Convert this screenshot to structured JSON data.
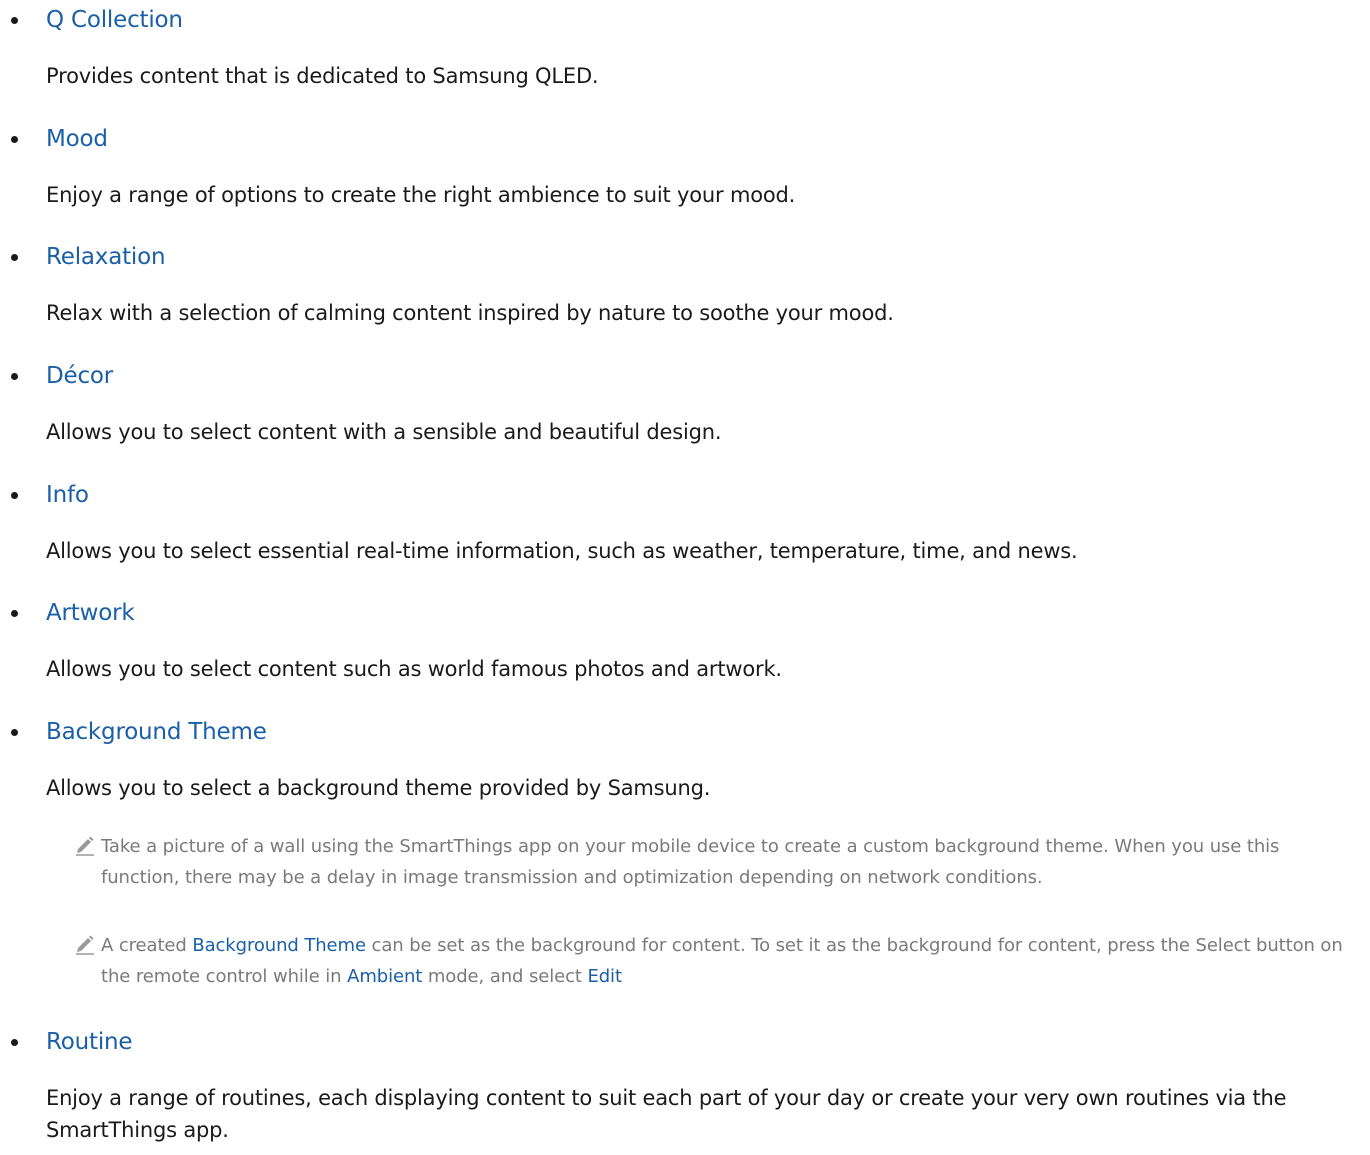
{
  "items": [
    {
      "title": "Q Collection",
      "description": "Provides content that is dedicated to Samsung QLED."
    },
    {
      "title": "Mood",
      "description": "Enjoy a range of options to create the right ambience to suit your mood."
    },
    {
      "title": "Relaxation",
      "description": "Relax with a selection of calming content inspired by nature to soothe your mood."
    },
    {
      "title": "Décor",
      "description": "Allows you to select content with a sensible and beautiful design."
    },
    {
      "title": "Info",
      "description": "Allows you to select essential real-time information, such as weather, temperature, time, and news."
    },
    {
      "title": "Artwork",
      "description": "Allows you to select content such as world famous photos and artwork."
    },
    {
      "title": "Background Theme",
      "description": "Allows you to select a background theme provided by Samsung."
    },
    {
      "title": "Routine",
      "description": "Enjoy a range of routines, each displaying content to suit each part of your day or create your very own routines via the SmartThings app."
    }
  ],
  "notes": [
    {
      "text": "Take a picture of a wall using the SmartThings app on your mobile device to create a custom background theme. When you use this function, there may be a delay in image transmission and optimization depending on network conditions."
    },
    {
      "part1": "A created ",
      "kw1": "Background Theme",
      "part2": " can be set as the background for content. To set it as the background for content, press the Select button on the remote control while in ",
      "kw2": "Ambient",
      "part3": " mode, and select ",
      "kw3": "Edit"
    }
  ],
  "colors": {
    "link": "#1a5fa8",
    "body_text": "#1a1a1a",
    "note_text": "#7a7a7a"
  },
  "icons": {
    "note": "pencil-icon"
  }
}
